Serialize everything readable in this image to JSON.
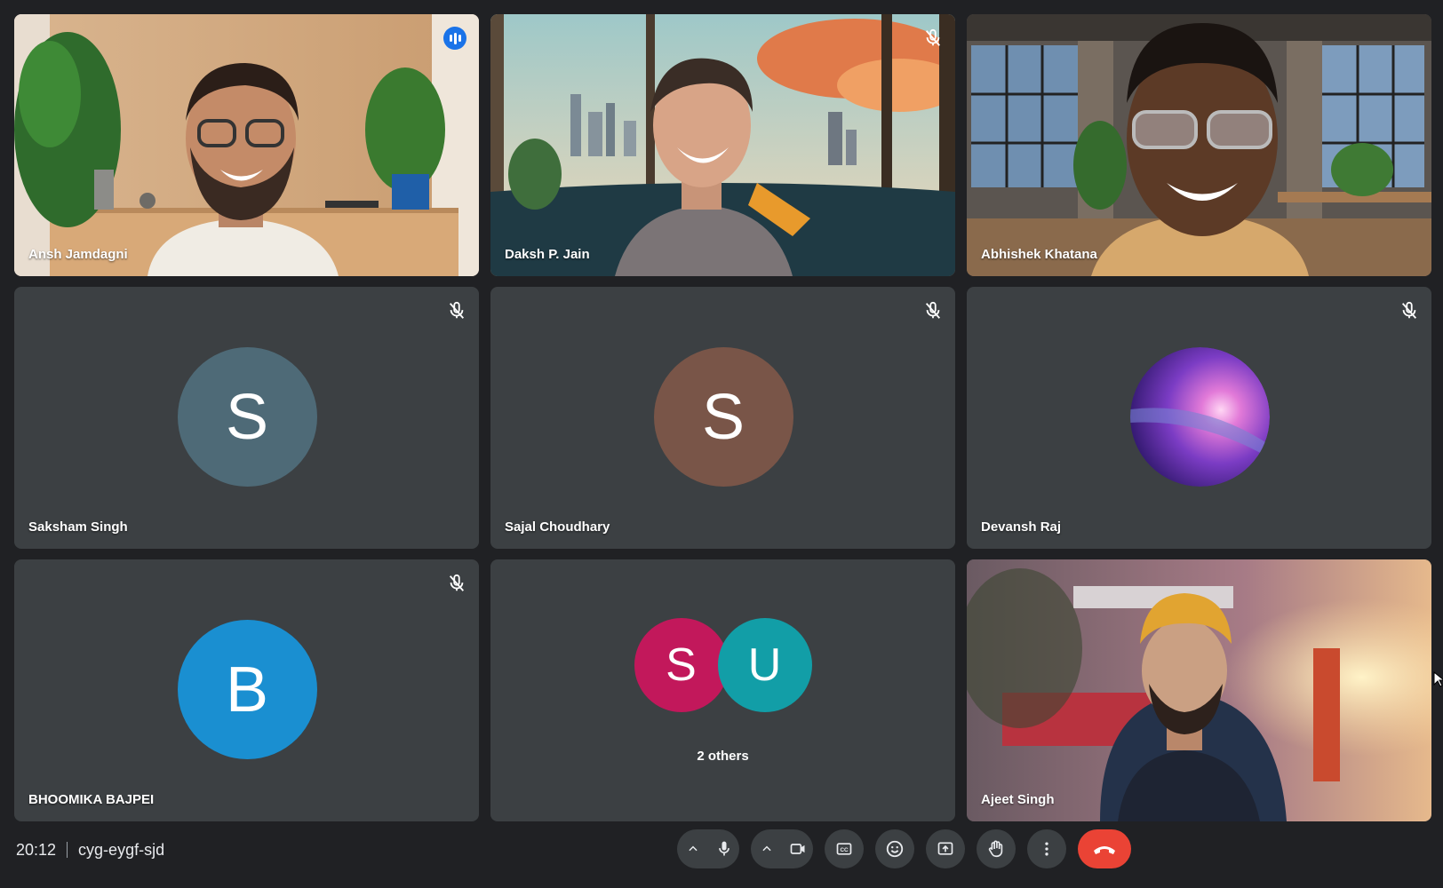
{
  "participants": [
    {
      "name": "Ansh Jamdagni",
      "type": "video",
      "speaking": true
    },
    {
      "name": "Daksh P. Jain",
      "type": "video",
      "muted": true
    },
    {
      "name": "Abhishek Khatana",
      "type": "video"
    },
    {
      "name": "Saksham Singh",
      "type": "avatar",
      "initial": "S",
      "avatar_color": "#4e6a77",
      "muted": true
    },
    {
      "name": "Sajal Choudhary",
      "type": "avatar",
      "initial": "S",
      "avatar_color": "#795548",
      "muted": true
    },
    {
      "name": "Devansh Raj",
      "type": "avatar-image",
      "muted": true
    },
    {
      "name": "BHOOMIKA BAJPEI",
      "type": "avatar",
      "initial": "B",
      "avatar_color": "#1a8fd1",
      "muted": true
    },
    {
      "name": "Ajeet Singh",
      "type": "video"
    }
  ],
  "others_tile": {
    "label": "2 others",
    "initials": [
      {
        "initial": "S",
        "color": "#c2185b"
      },
      {
        "initial": "U",
        "color": "#129ea7"
      }
    ]
  },
  "meeting": {
    "time": "20:12",
    "code": "cyg-eygf-sjd"
  },
  "controls": [
    "mic-options-icon",
    "microphone-icon",
    "camera-options-icon",
    "camera-icon",
    "captions-icon",
    "emoji-icon",
    "present-icon",
    "raise-hand-icon",
    "more-options-icon",
    "end-call-icon"
  ],
  "colors": {
    "background": "#202124",
    "tile": "#3c4043",
    "accent": "#8ab4f8",
    "end_call": "#ea4335"
  }
}
